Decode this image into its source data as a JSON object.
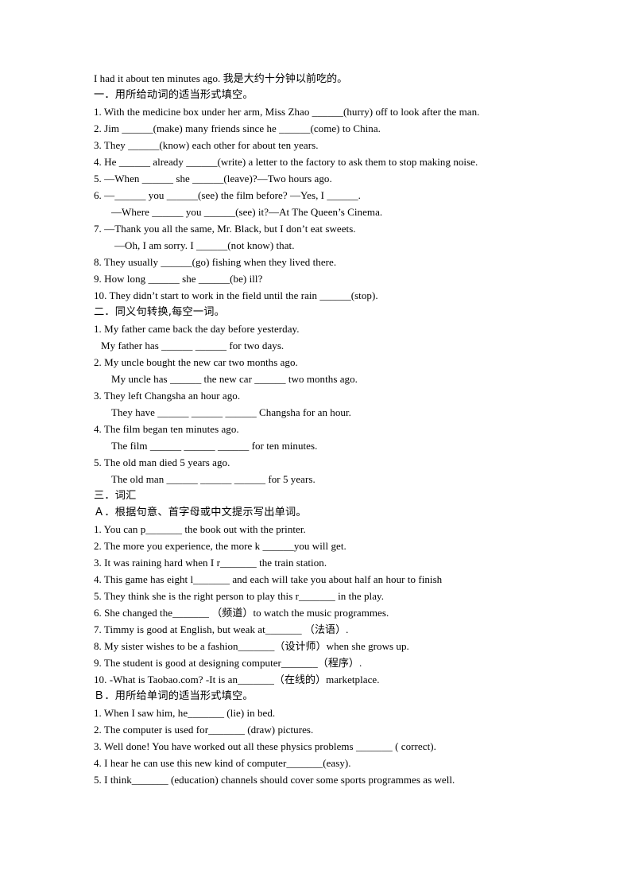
{
  "document": {
    "intro_line": "I had it about ten minutes ago.  我是大约十分钟以前吃的。",
    "sections": [
      {
        "heading": "一．用所给动词的适当形式填空。",
        "items": [
          "1. With the medicine box under her arm, Miss Zhao ______(hurry) off to look after the man.",
          "2. Jim ______(make) many friends since he ______(come) to China.",
          "3. They ______(know) each other for about ten years.",
          "4. He ______ already ______(write) a letter to the factory to ask them to stop making noise.",
          "5. —When ______ she ______(leave)?—Two hours ago.",
          "6. —______ you ______(see) the film before? —Yes, I ______.",
          "—Where ______ you ______(see) it?—At The Queen’s Cinema.",
          "7. —Thank you all the same, Mr. Black, but I don’t eat sweets.",
          "—Oh, I am sorry. I ______(not know) that.",
          "8. They usually ______(go) fishing when they lived there.",
          "9. How long ______ she ______(be) ill?",
          "10. They didn’t start to work in the field until the rain ______(stop)."
        ]
      },
      {
        "heading": "二．同义句转换,每空一词。",
        "items": [
          "1. My father came back the day before yesterday.",
          "My father has ______ ______ for two days.",
          "2. My uncle bought the new car two months ago.",
          "My uncle has ______ the new car ______ two months ago.",
          "3. They left Changsha an hour ago.",
          "They have ______ ______ ______ Changsha for an hour.",
          "4. The film began ten minutes ago.",
          "The film ______ ______ ______ for ten minutes.",
          "5. The old man died 5 years ago.",
          "The old man ______ ______ ______ for 5 years."
        ]
      },
      {
        "heading": "三．词汇",
        "subsections": [
          {
            "heading": "Ａ．根据句意、首字母或中文提示写出单词。",
            "items": [
              "1. You can p_______ the book out with the printer.",
              "2. The more you experience, the more k ______you will get.",
              "3. It was raining hard when I r_______ the train station.",
              "4. This game has eight l_______ and each will take you about half an hour to finish",
              "5. They think she is the right person to play this r_______ in the play.",
              "6. She changed the_______ （频道）to watch the music programmes.",
              "7. Timmy is good at English, but weak at_______ （法语）.",
              "8. My sister wishes to be a fashion_______（设计师）when she grows up.",
              "9. The student is good at designing computer_______（程序）.",
              "10. -What is Taobao.com?    -It is an_______（在线的）marketplace."
            ]
          },
          {
            "heading": "Ｂ．用所给单词的适当形式填空。",
            "items": [
              "1. When I saw him, he_______ (lie) in bed.",
              "2. The computer is used for_______ (draw) pictures.",
              "3. Well done! You have worked out all these physics problems _______ ( correct).",
              "4. I hear he can use this new kind of computer_______(easy).",
              "5. I think_______ (education) channels should cover some sports programmes as well."
            ]
          }
        ]
      }
    ]
  },
  "colors": {
    "page_background": "#ffffff",
    "text": "#000000"
  }
}
